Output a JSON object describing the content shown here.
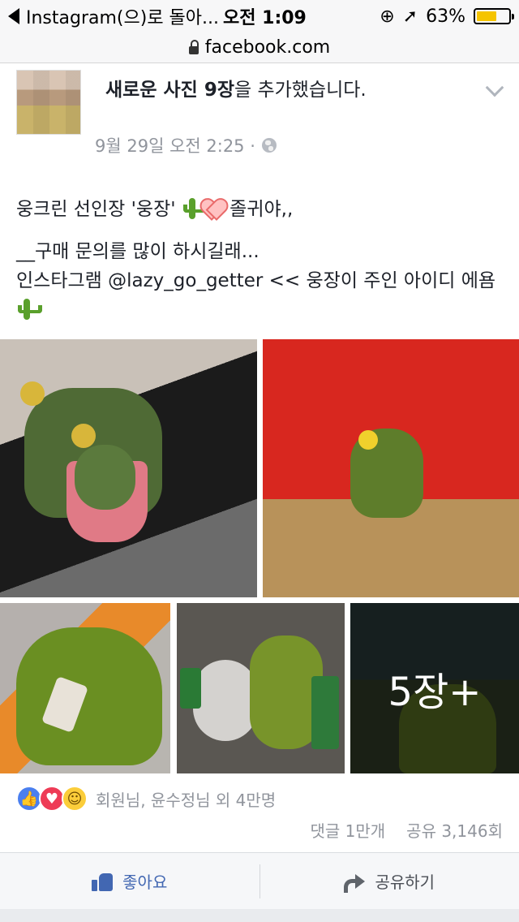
{
  "status_bar": {
    "back_app": "Instagram(으)로 돌아...",
    "time": "오전 1:09",
    "battery": "63%",
    "battery_level": 0.63
  },
  "browser": {
    "url": "facebook.com"
  },
  "post": {
    "title_bold_1": "새로운 사진 9장",
    "title_rest": "을 추가했습니다.",
    "timestamp": "9월 29일 오전 2:25 ·",
    "text_line_1a": "웅크린 선인장 '웅장' ",
    "text_line_1b": " 졸귀야,,",
    "text_line_2": "__구매 문의를 많이 하시길래...",
    "text_line_3": "인스타그램 @lazy_go_getter << 웅장이 주인 아이디 에욤",
    "more_photos": "5장+"
  },
  "reactions": {
    "names": "회원님, 윤수정님 외 4만명",
    "comments": "댓글 1만개",
    "shares": "공유 3,146회"
  },
  "actions": {
    "like": "좋아요",
    "share": "공유하기"
  },
  "icons": [
    "back-arrow-icon",
    "lock-icon",
    "location-arrow-icon",
    "rotation-lock-icon",
    "battery-icon",
    "chevron-down-icon",
    "globe-icon",
    "cactus-emoji",
    "heart-emoji",
    "like-reaction-icon",
    "love-reaction-icon",
    "haha-reaction-icon",
    "thumbs-up-icon",
    "share-arrow-icon"
  ]
}
